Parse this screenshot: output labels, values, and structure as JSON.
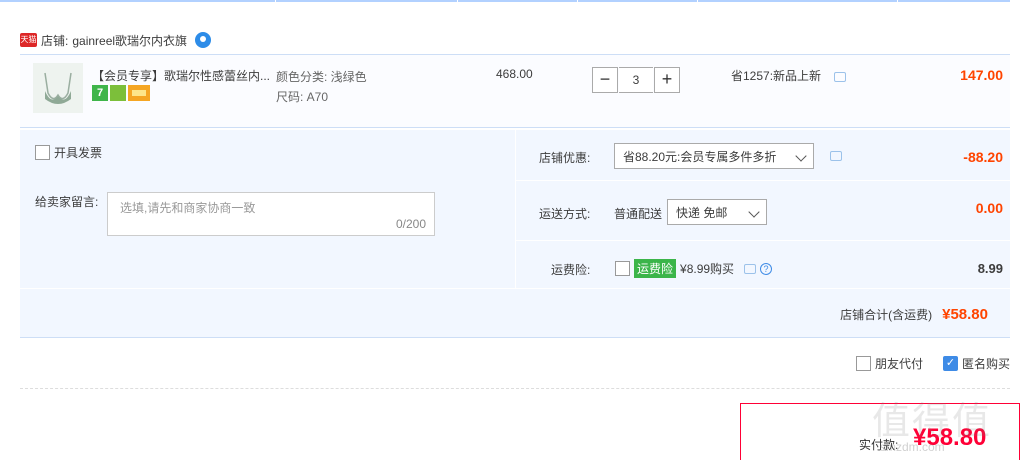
{
  "shop": {
    "prefix": "店铺:",
    "name": "gainreel歌瑞尔内衣旗",
    "badge": "天猫"
  },
  "item": {
    "title": "【会员专享】歌瑞尔性感蕾丝内...",
    "sku_color": "颜色分类: 浅绿色",
    "sku_size": "尺码: A70",
    "price": "468.00",
    "qty": "3",
    "qty_minus": "−",
    "qty_plus": "+",
    "promo": "省1257:新品上新",
    "subtotal": "147.00",
    "icon7": "7"
  },
  "options": {
    "invoice_label": "开具发票",
    "message_label": "给卖家留言:",
    "message_placeholder": "选填,请先和商家协商一致",
    "message_count": "0/200",
    "discount_label": "店铺优惠:",
    "discount_value": "省88.20元:会员专属多件多折",
    "discount_amount": "-88.20",
    "shipping_label": "运送方式:",
    "shipping_type": "普通配送",
    "shipping_select": "快递 免邮",
    "shipping_amount": "0.00",
    "insurance_label": "运费险:",
    "insurance_tag": "运费险",
    "insurance_price": "¥8.99购买",
    "insurance_amount": "8.99",
    "help_glyph": "?"
  },
  "total": {
    "label": "店铺合计(含运费)",
    "amount": "¥58.80"
  },
  "pay_options": {
    "friend_pay": "朋友代付",
    "anonymous": "匿名购买",
    "check_glyph": "✓"
  },
  "final": {
    "label": "实付款:",
    "amount": "¥58.80"
  },
  "watermark": {
    "text": "值得值",
    "url": "smzdm.com"
  },
  "colors": {
    "price_red": "#f40",
    "accent_blue": "#3e8be6",
    "panel_bg": "#f2f7ff"
  }
}
